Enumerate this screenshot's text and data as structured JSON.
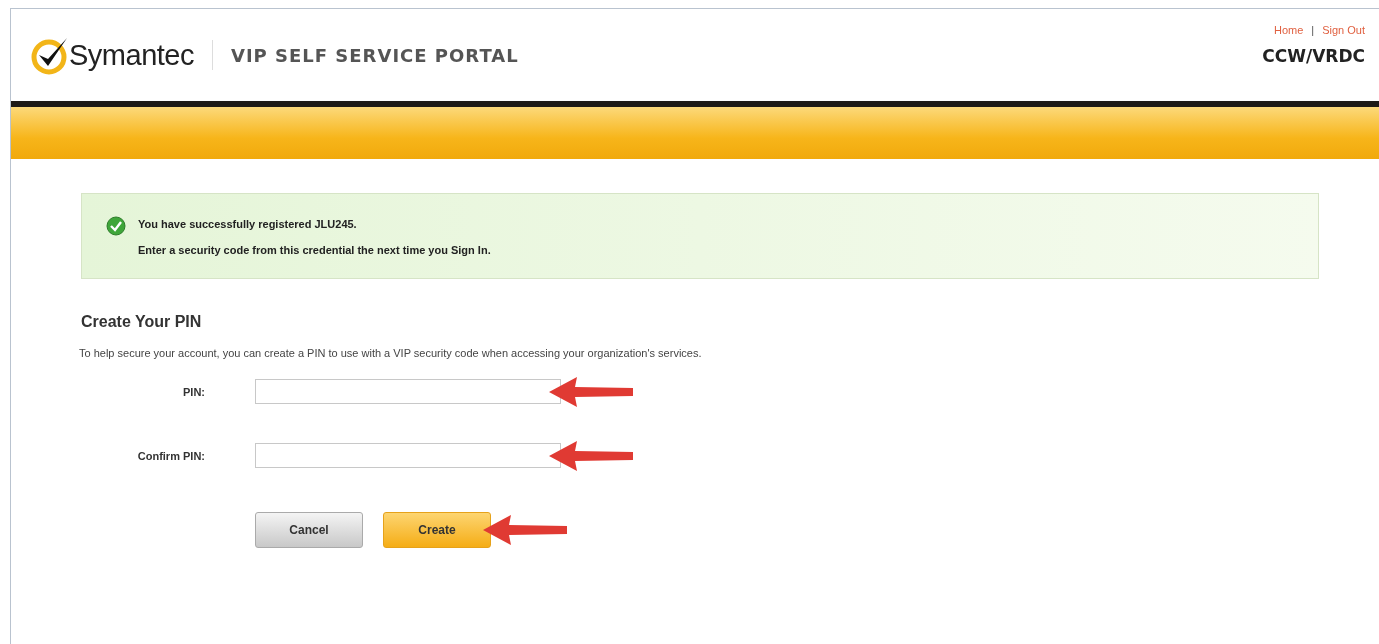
{
  "header": {
    "brand": "Symantec",
    "portal_title": "VIP SELF SERVICE PORTAL",
    "links": [
      "Home",
      "Sign Out"
    ],
    "link_separator": "|",
    "organization": "CCW/VRDC"
  },
  "message": {
    "lines": [
      "You have successfully registered JLU245.",
      "Enter a security code from this credential the next time you Sign In."
    ]
  },
  "form": {
    "heading": "Create Your PIN",
    "description": "To help secure your account, you can create a PIN to use with a VIP security code when accessing your organization's services.",
    "fields": [
      {
        "label": "PIN:",
        "arrow": true
      },
      {
        "label": "Confirm PIN:",
        "arrow": true
      }
    ],
    "buttons": [
      {
        "label": "Cancel",
        "kind": "secondary",
        "arrow": false
      },
      {
        "label": "Create",
        "kind": "primary",
        "arrow": true
      }
    ]
  }
}
